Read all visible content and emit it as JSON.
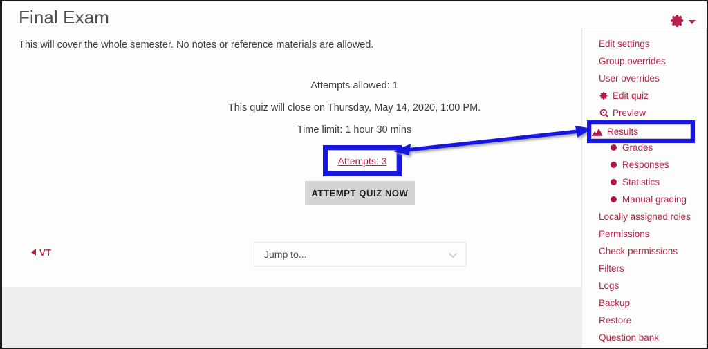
{
  "page": {
    "title": "Final Exam",
    "intro": "This will cover the whole semester. No notes or reference materials are allowed."
  },
  "quiz_info": {
    "attempts_allowed": "Attempts allowed: 1",
    "close_date": "This quiz will close on Thursday, May 14, 2020, 1:00 PM.",
    "time_limit": "Time limit: 1 hour 30 mins",
    "attempts_link": "Attempts: 3",
    "attempt_button": "ATTEMPT QUIZ NOW"
  },
  "footer_nav": {
    "previous_activity": "VT",
    "jump_to_placeholder": "Jump to...",
    "chevron_icon": "chevron-down-icon"
  },
  "settings_menu": {
    "toggle_icon": "gear-icon",
    "caret_icon": "caret-down-icon",
    "items": [
      {
        "label": "Edit settings",
        "icon": null,
        "indented": false
      },
      {
        "label": "Group overrides",
        "icon": null,
        "indented": false
      },
      {
        "label": "User overrides",
        "icon": null,
        "indented": false
      },
      {
        "label": "Edit quiz",
        "icon": "gear-icon",
        "indented": false
      },
      {
        "label": "Preview",
        "icon": "search-icon",
        "indented": false
      },
      {
        "label": "Results",
        "icon": "chart-icon",
        "indented": false
      },
      {
        "label": "Grades",
        "icon": "bullet-icon",
        "indented": true
      },
      {
        "label": "Responses",
        "icon": "bullet-icon",
        "indented": true
      },
      {
        "label": "Statistics",
        "icon": "bullet-icon",
        "indented": true
      },
      {
        "label": "Manual grading",
        "icon": "bullet-icon",
        "indented": true
      },
      {
        "label": "Locally assigned roles",
        "icon": null,
        "indented": false
      },
      {
        "label": "Permissions",
        "icon": null,
        "indented": false
      },
      {
        "label": "Check permissions",
        "icon": null,
        "indented": false
      },
      {
        "label": "Filters",
        "icon": null,
        "indented": false
      },
      {
        "label": "Logs",
        "icon": null,
        "indented": false
      },
      {
        "label": "Backup",
        "icon": null,
        "indented": false
      },
      {
        "label": "Restore",
        "icon": null,
        "indented": false
      },
      {
        "label": "Question bank",
        "icon": null,
        "indented": false
      }
    ]
  },
  "annotations": {
    "highlight_color": "#1616e0",
    "highlighted_targets": [
      "Attempts: 3",
      "Results"
    ],
    "arrow": "double-headed-arrow"
  },
  "colors": {
    "link": "#b8204a",
    "title": "#4a4f57",
    "page_bg": "#ededec",
    "card_bg": "#fdfdfb",
    "button_bg": "#d4d4d4"
  }
}
